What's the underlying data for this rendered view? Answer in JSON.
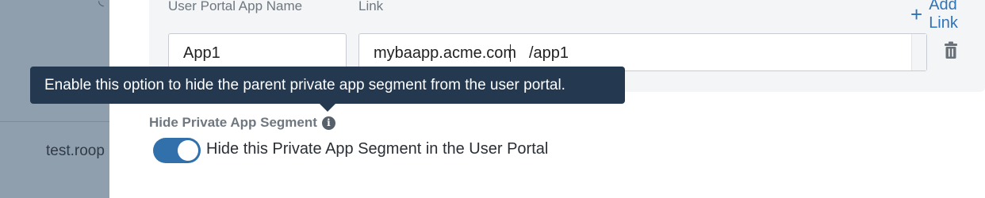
{
  "sidebar": {
    "item_text": "test.roop"
  },
  "links_table": {
    "name_header": "User Portal App Name",
    "link_header": "Link",
    "add_link_label": "Add Link",
    "row": {
      "app_name": "App1",
      "link_host": "mybaapp.acme.com",
      "link_path": "/app1"
    }
  },
  "tooltip": {
    "text": "Enable this option to hide the parent private app segment from the user portal."
  },
  "hide_segment": {
    "section_label": "Hide Private App Segment",
    "toggle_on": true,
    "toggle_label": "Hide this Private App Segment in the User Portal"
  },
  "colors": {
    "accent": "#3270ac",
    "tooltip_bg": "#24384f",
    "sidebar_bg": "#8f9fae"
  }
}
